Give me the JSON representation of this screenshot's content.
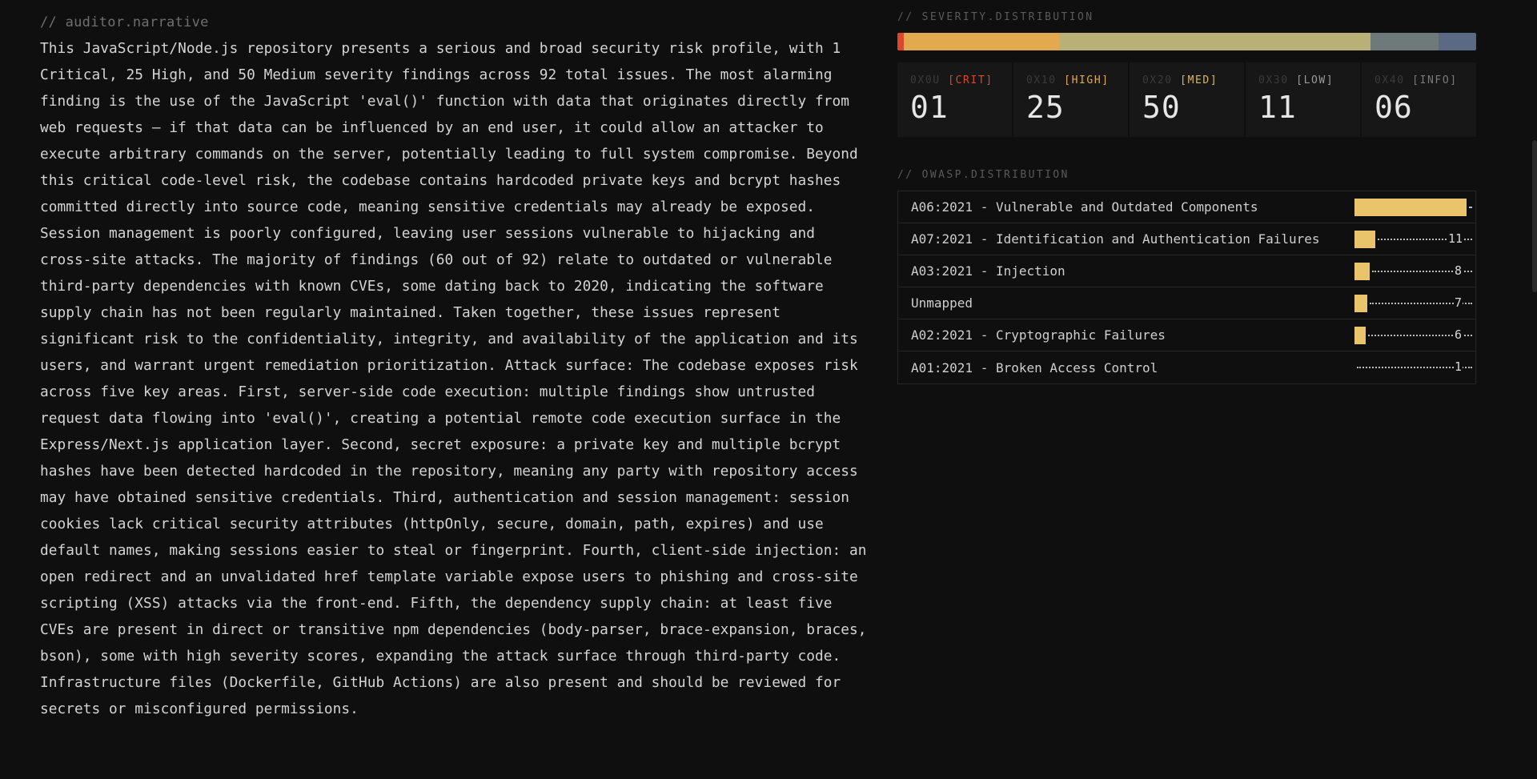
{
  "narrative": {
    "label": "// auditor.narrative",
    "text": "This JavaScript/Node.js repository presents a serious and broad security risk profile, with 1 Critical, 25 High, and 50 Medium severity findings across 92 total issues. The most alarming finding is the use of the JavaScript 'eval()' function with data that originates directly from web requests — if that data can be influenced by an end user, it could allow an attacker to execute arbitrary commands on the server, potentially leading to full system compromise. Beyond this critical code-level risk, the codebase contains hardcoded private keys and bcrypt hashes committed directly into source code, meaning sensitive credentials may already be exposed. Session management is poorly configured, leaving user sessions vulnerable to hijacking and cross-site attacks. The majority of findings (60 out of 92) relate to outdated or vulnerable third-party dependencies with known CVEs, some dating back to 2020, indicating the software supply chain has not been regularly maintained. Taken together, these issues represent significant risk to the confidentiality, integrity, and availability of the application and its users, and warrant urgent remediation prioritization. Attack surface: The codebase exposes risk across five key areas. First, server-side code execution: multiple findings show untrusted request data flowing into 'eval()', creating a potential remote code execution surface in the Express/Next.js application layer. Second, secret exposure: a private key and multiple bcrypt hashes have been detected hardcoded in the repository, meaning any party with repository access may have obtained sensitive credentials. Third, authentication and session management: session cookies lack critical security attributes (httpOnly, secure, domain, path, expires) and use default names, making sessions easier to steal or fingerprint. Fourth, client-side injection: an open redirect and an unvalidated href template variable expose users to phishing and cross-site scripting (XSS) attacks via the front-end. Fifth, the dependency supply chain: at least five CVEs are present in direct or transitive npm dependencies (body-parser, brace-expansion, braces, bson), some with high severity scores, expanding the attack surface through third-party code. Infrastructure files (Dockerfile, GitHub Actions) are also present and should be reviewed for secrets or misconfigured permissions."
  },
  "severity": {
    "label": "// SEVERITY.DISTRIBUTION",
    "bar_segments": [
      {
        "name": "crit",
        "value": 1,
        "color": "#d9482b"
      },
      {
        "name": "high",
        "value": 25,
        "color": "#e3a94e"
      },
      {
        "name": "med",
        "value": 50,
        "color": "#b9b078"
      },
      {
        "name": "low",
        "value": 11,
        "color": "#6e7a79"
      },
      {
        "name": "info",
        "value": 6,
        "color": "#5a6a85"
      }
    ],
    "cards": [
      {
        "hex": "0X0U",
        "tag": "[CRIT]",
        "count": "01",
        "color": "#d9482b"
      },
      {
        "hex": "0X10",
        "tag": "[HIGH]",
        "count": "25",
        "color": "#e3a94e"
      },
      {
        "hex": "0X20",
        "tag": "[MED]",
        "count": "50",
        "color": "#d8b86a"
      },
      {
        "hex": "0X30",
        "tag": "[LOW]",
        "count": "11",
        "color": "#9a9a9a"
      },
      {
        "hex": "0X40",
        "tag": "[INFO]",
        "count": "06",
        "color": "#7a7a7a"
      }
    ]
  },
  "owasp": {
    "label": "// OWASP.DISTRIBUTION",
    "max_value": 60,
    "rows": [
      {
        "name": "A06:2021 - Vulnerable and Outdated Components",
        "count": ""
      },
      {
        "name": "A07:2021 - Identification and Authentication Failures",
        "count": "11"
      },
      {
        "name": "A03:2021 - Injection",
        "count": "8"
      },
      {
        "name": "Unmapped",
        "count": "7"
      },
      {
        "name": "A02:2021 - Cryptographic Failures",
        "count": "6"
      },
      {
        "name": "A01:2021 - Broken Access Control",
        "count": "1"
      }
    ],
    "values": [
      60,
      11,
      8,
      7,
      6,
      1
    ],
    "fill_color": "#e9c46a"
  }
}
